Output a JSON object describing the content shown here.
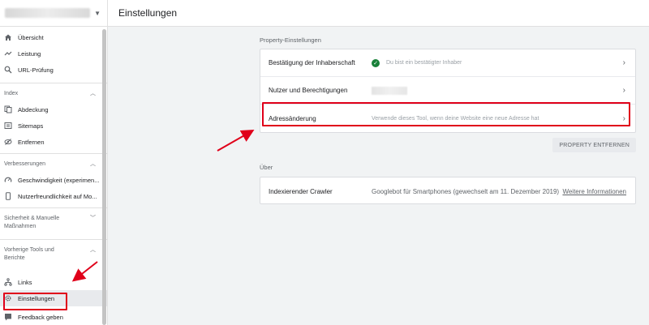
{
  "sidebar": {
    "items_top": [
      {
        "label": "Übersicht",
        "icon": "home-icon"
      },
      {
        "label": "Leistung",
        "icon": "trending-icon"
      },
      {
        "label": "URL-Prüfung",
        "icon": "search-icon"
      }
    ],
    "sections": [
      {
        "title": "Index",
        "items": [
          {
            "label": "Abdeckung",
            "icon": "copy-icon"
          },
          {
            "label": "Sitemaps",
            "icon": "sitemap-icon"
          },
          {
            "label": "Entfernen",
            "icon": "eye-off-icon"
          }
        ]
      },
      {
        "title": "Verbesserungen",
        "items": [
          {
            "label": "Geschwindigkeit (experimen...",
            "icon": "speedometer-icon"
          },
          {
            "label": "Nutzerfreundlichkeit auf Mo...",
            "icon": "phone-icon"
          }
        ]
      },
      {
        "title": "Sicherheit & Manuelle Maßnahmen",
        "items": []
      },
      {
        "title": "Vorherige Tools und Berichte",
        "items": [
          {
            "label": "Links",
            "icon": "links-icon"
          },
          {
            "label": "Einstellungen",
            "icon": "gear-icon"
          },
          {
            "label": "Feedback geben",
            "icon": "feedback-icon"
          }
        ]
      }
    ]
  },
  "header": {
    "title": "Einstellungen"
  },
  "property_settings": {
    "label": "Property-Einstellungen",
    "rows": [
      {
        "title": "Bestätigung der Inhaberschaft",
        "desc": "Du bist ein bestätigter Inhaber"
      },
      {
        "title": "Nutzer und Berechtigungen",
        "desc": ""
      },
      {
        "title": "Adressänderung",
        "desc": "Verwende dieses Tool, wenn deine Website eine neue Adresse hat"
      }
    ],
    "remove_button": "PROPERTY ENTFERNEN"
  },
  "about": {
    "label": "Über",
    "crawler_title": "Indexierender Crawler",
    "crawler_value": "Googlebot für Smartphones (gewechselt am 11. Dezember 2019)",
    "more_link": "Weitere Informationen"
  },
  "colors": {
    "highlight": "#e0001a",
    "success": "#188038"
  }
}
